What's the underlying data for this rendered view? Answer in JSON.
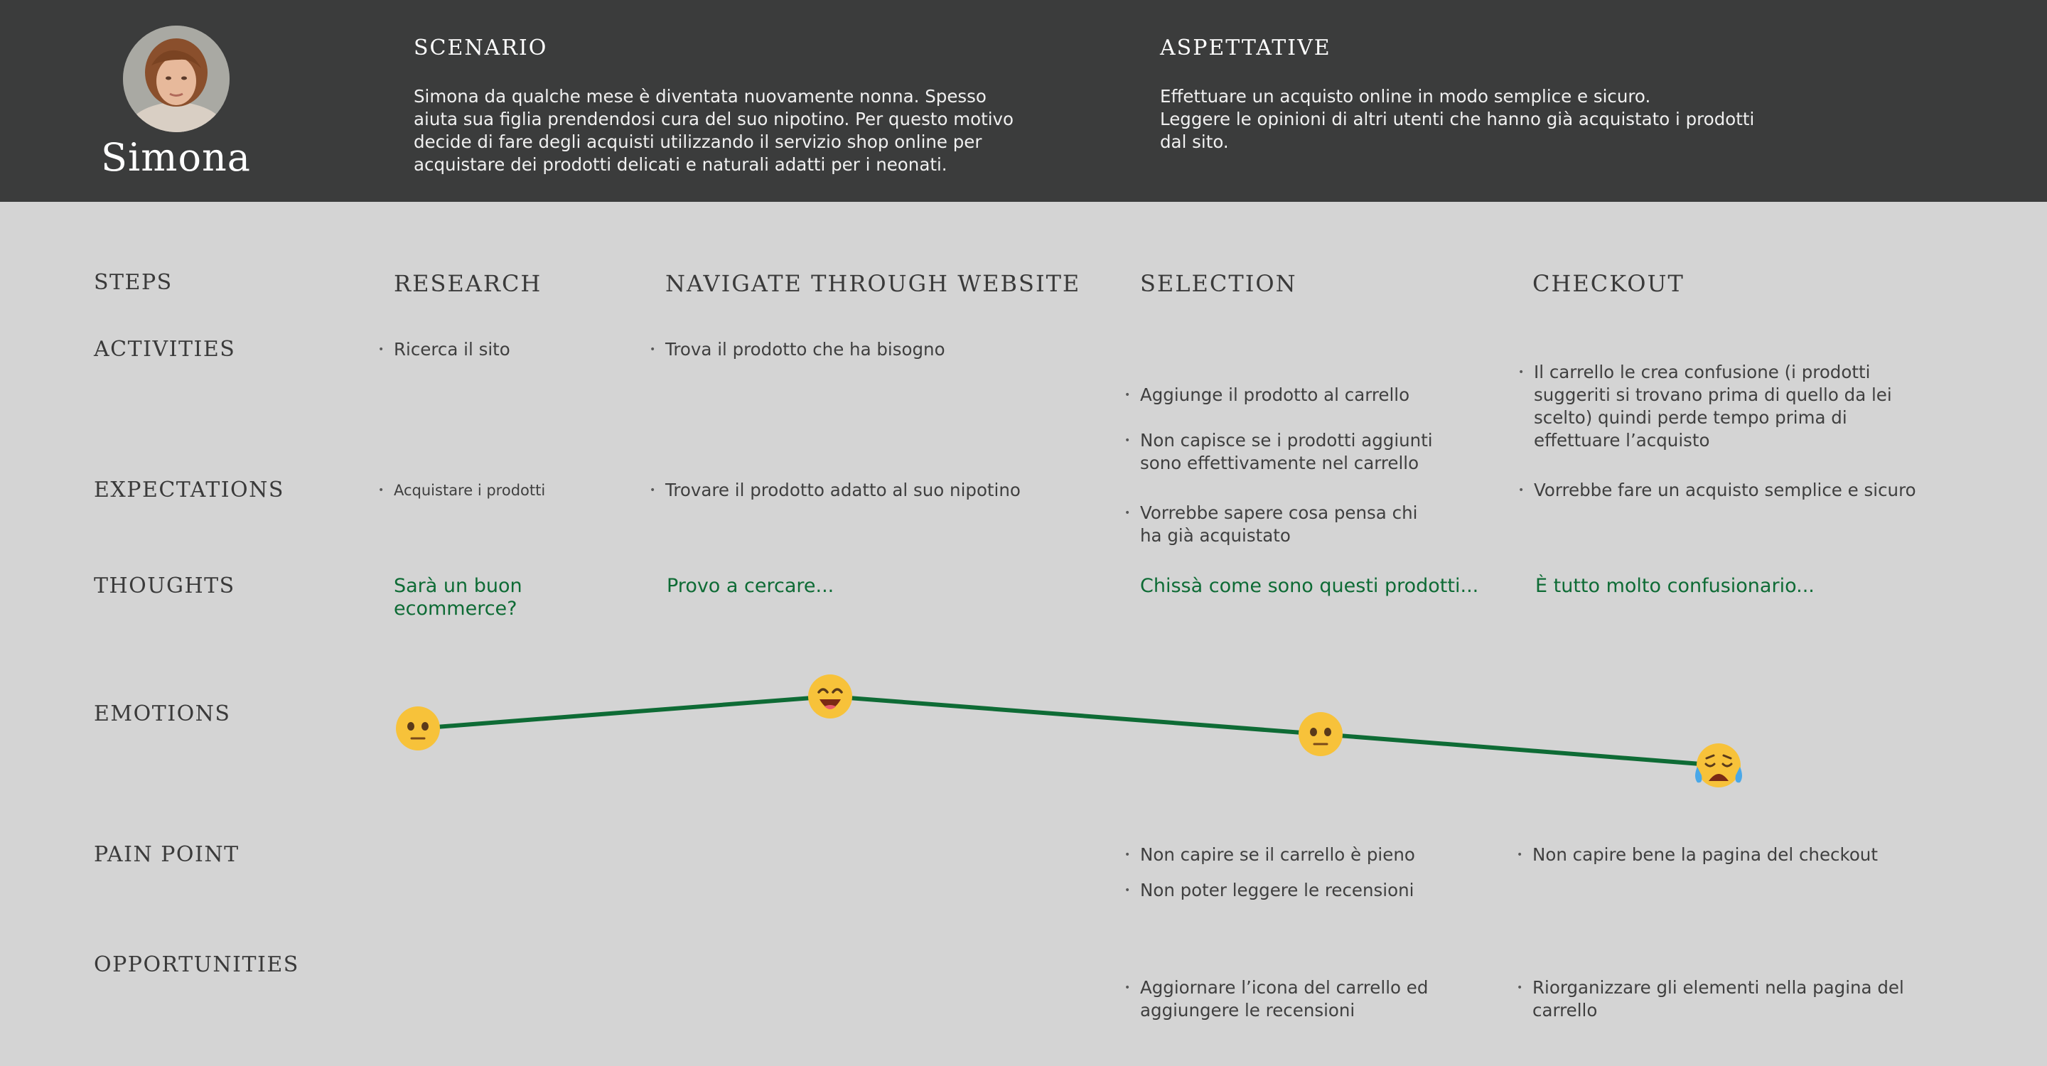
{
  "persona": {
    "name": "Simona"
  },
  "header": {
    "scenario_title": "SCENARIO",
    "scenario_text": "Simona da qualche mese è diventata nuovamente nonna. Spesso\naiuta sua figlia prendendosi cura del suo nipotino. Per questo motivo\ndecide di fare degli acquisti utilizzando il servizio shop online per\nacquistare dei prodotti delicati e naturali adatti per i neonati.",
    "expectations_title": "ASPETTATIVE",
    "expectations_text": "Effettuare un acquisto online in modo semplice e sicuro.\nLeggere le opinioni di altri utenti che hanno già acquistato i prodotti\ndal sito."
  },
  "rows": {
    "steps": "STEPS",
    "activities": "ACTIVITIES",
    "expectations": "EXPECTATIONS",
    "thoughts": "THOUGHTS",
    "emotions": "EMOTIONS",
    "pain_point": "PAIN POINT",
    "opportunities": "OPPORTUNITIES"
  },
  "steps": [
    {
      "title": "RESEARCH",
      "activities": [
        "Ricerca il sito"
      ],
      "expectations": [
        "Acquistare i prodotti"
      ],
      "thought": "Sarà un buon\necommerce?",
      "emotion": "neutral-face-icon",
      "pain_points": [],
      "opportunities": []
    },
    {
      "title": "NAVIGATE THROUGH WEBSITE",
      "activities": [
        "Trova il prodotto che ha bisogno"
      ],
      "expectations": [
        "Trovare il prodotto adatto al suo nipotino"
      ],
      "thought": "Provo a cercare...",
      "emotion": "grinning-face-icon",
      "pain_points": [],
      "opportunities": []
    },
    {
      "title": "SELECTION",
      "activities": [
        "Aggiunge il prodotto al carrello",
        "Non capisce se i prodotti aggiunti\nsono effettivamente nel carrello"
      ],
      "expectations": [
        "Vorrebbe sapere cosa pensa chi\nha già acquistato"
      ],
      "thought": "Chissà come sono questi prodotti...",
      "emotion": "neutral-face-icon",
      "pain_points": [
        "Non capire se il carrello è pieno",
        "Non poter leggere le recensioni"
      ],
      "opportunities": [
        "Aggiornare l’icona del carrello ed\naggiungere le recensioni"
      ]
    },
    {
      "title": "CHECKOUT",
      "activities": [
        "Il carrello le crea confusione (i prodotti\nsuggeriti si trovano prima di quello da lei\nscelto) quindi perde tempo prima di\neffettuare l’acquisto"
      ],
      "expectations": [
        "Vorrebbe fare un acquisto semplice e sicuro"
      ],
      "thought": "È tutto molto confusionario...",
      "emotion": "crying-face-icon",
      "pain_points": [
        "Non capire bene la pagina del checkout"
      ],
      "opportunities": [
        "Riorganizzare gli elementi nella pagina del\ncarrello"
      ]
    }
  ],
  "emotion_levels": [
    0,
    1,
    0,
    -1
  ],
  "colors": {
    "header_bg": "#3b3c3c",
    "page_bg": "#d4d4d4",
    "accent_green": "#0e6b35",
    "emoji_yellow": "#f7c23a"
  }
}
